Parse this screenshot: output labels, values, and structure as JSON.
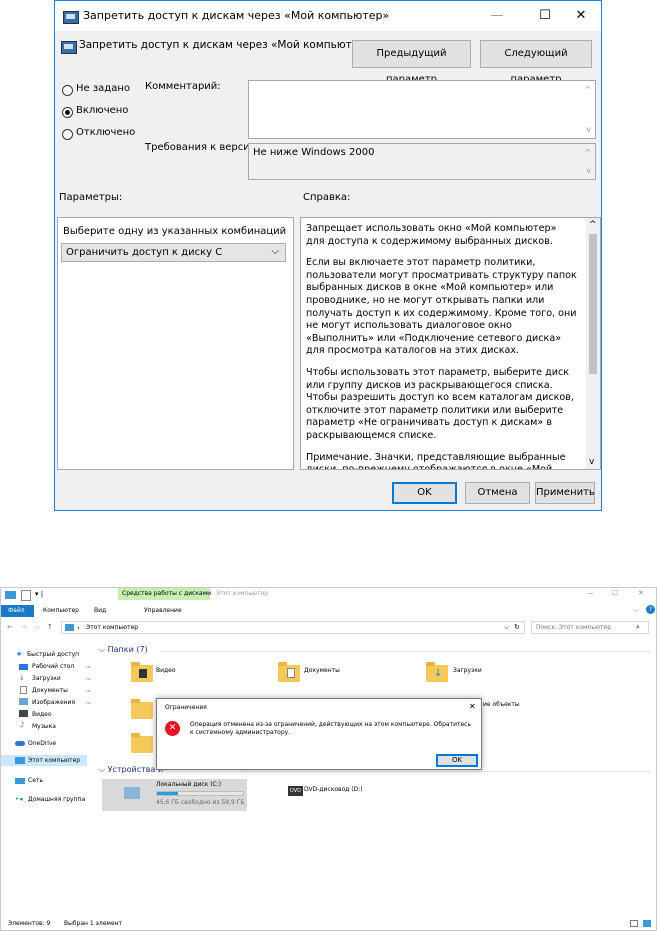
{
  "policy": {
    "window_title": "Запретить доступ к дискам через «Мой компьютер»",
    "setting_title": "Запретить доступ к дискам через «Мой компьютер»",
    "prev_button": "Предыдущий параметр",
    "next_button": "Следующий параметр",
    "radio_not_configured": "Не задано",
    "radio_enabled": "Включено",
    "radio_disabled": "Отключено",
    "selected_radio": "Включено",
    "comment_label": "Комментарий:",
    "comment_value": "",
    "supported_label": "Требования к версии:",
    "supported_value": "Не ниже Windows 2000",
    "options_label": "Параметры:",
    "help_label": "Справка:",
    "options_prompt": "Выберите одну из указанных комбинаций",
    "options_selected": "Ограничить доступ к диску C",
    "help_paragraphs": [
      "Запрещает использовать окно «Мой компьютер» для доступа к содержимому выбранных дисков.",
      "Если вы включаете этот параметр политики, пользователи могут просматривать структуру папок выбранных дисков в окне «Мой компьютер» или проводнике, но не могут открывать папки или получать доступ к их содержимому. Кроме того, они не могут использовать диалоговое окно «Выполнить» или «Подключение сетевого диска» для просмотра каталогов на этих дисках.",
      "Чтобы использовать этот параметр, выберите диск или группу дисков из раскрывающегося списка. Чтобы разрешить доступ ко всем каталогам дисков, отключите этот параметр политики или выберите параметр «Не ограничивать доступ к дискам» в раскрывающемся списке.",
      "Примечание. Значки, представляющие выбранные диски, по-прежнему отображаются в окне «Мой компьютер», но если пользователь дважды щелкает эти значки, появляется"
    ],
    "ok_button": "OK",
    "cancel_button": "Отмена",
    "apply_button": "Применить"
  },
  "explorer": {
    "ribbon_context_tab": "Средства работы с дисками",
    "window_title": "Этот компьютер",
    "tabs": [
      "Файл",
      "Компьютер",
      "Вид"
    ],
    "context_subtab": "Управление",
    "address": "Этот компьютер",
    "search_placeholder": "Поиск: Этот компьютер",
    "nav": {
      "quick_access": "Быстрый доступ",
      "desktop": "Рабочий стол",
      "downloads": "Загрузки",
      "documents": "Документы",
      "pictures": "Изображения",
      "video": "Видео",
      "music": "Музыка",
      "onedrive": "OneDrive",
      "this_pc": "Этот компьютер",
      "network": "Сеть",
      "homegroup": "Домашняя группа"
    },
    "folders_header": "Папки (7)",
    "folders": [
      "Видео",
      "Документы",
      "Загрузки",
      "ие объекты"
    ],
    "devices_header": "Устройства и",
    "drive_c_name": "Локальный диск (C:)",
    "drive_c_free": "45,6 ГБ свободно из 59,9 ГБ",
    "drive_c_used_fraction": 0.24,
    "dvd_name": "DVD-дисковод (D:)",
    "dvd_badge": "DVD",
    "status_items": "Элементов: 9",
    "status_selected": "Выбран 1 элемент",
    "error_dialog": {
      "title": "Ограничения",
      "message": "Операция отменена из-за ограничений, действующих на этом компьютере. Обратитесь к системному администратору.",
      "ok": "OK"
    }
  },
  "colors": {
    "accent": "#0078d7",
    "context_tab": "#c6efb0",
    "progress": "#26a0da",
    "error_red": "#e81123",
    "folder": "#f4c95a"
  }
}
